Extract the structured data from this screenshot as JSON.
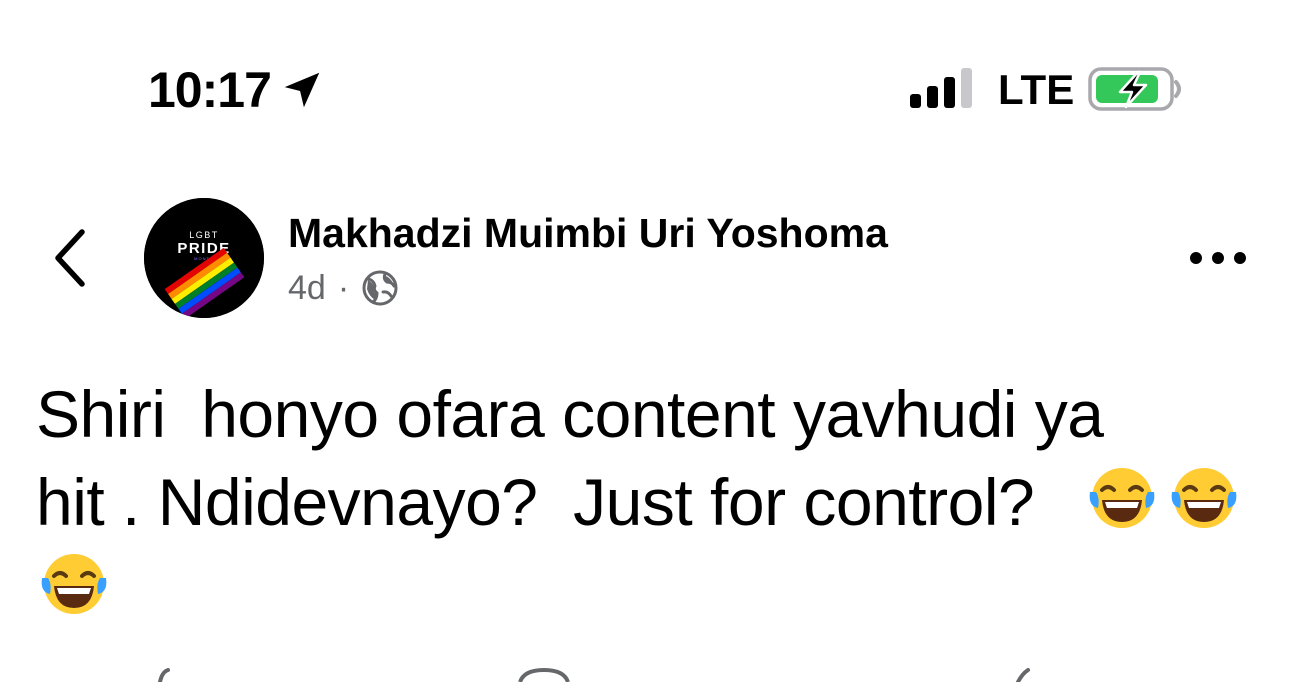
{
  "status_bar": {
    "time": "10:17",
    "network": "LTE",
    "icons": [
      "location-arrow-icon",
      "cellular-signal-icon",
      "battery-charging-icon"
    ],
    "battery_color": "#34c759"
  },
  "post": {
    "author": "Makhadzi Muimbi Uri Yoshoma",
    "age": "4d",
    "separator": "·",
    "privacy_icon": "globe-icon",
    "avatar": {
      "line1": "LGBT",
      "line2": "PRIDE",
      "line3": "MONTH"
    },
    "text_line1": "Shiri  honyo ofara content yavhudi ya",
    "text_line2": "hit . Ndidevnayo?  Just for control?",
    "emoji": [
      "laughing-tears-emoji",
      "laughing-tears-emoji",
      "laughing-tears-emoji"
    ],
    "meta_color": "#65676b"
  },
  "header": {
    "back_icon": "chevron-left-icon",
    "more_icon": "more-horizontal-icon"
  }
}
